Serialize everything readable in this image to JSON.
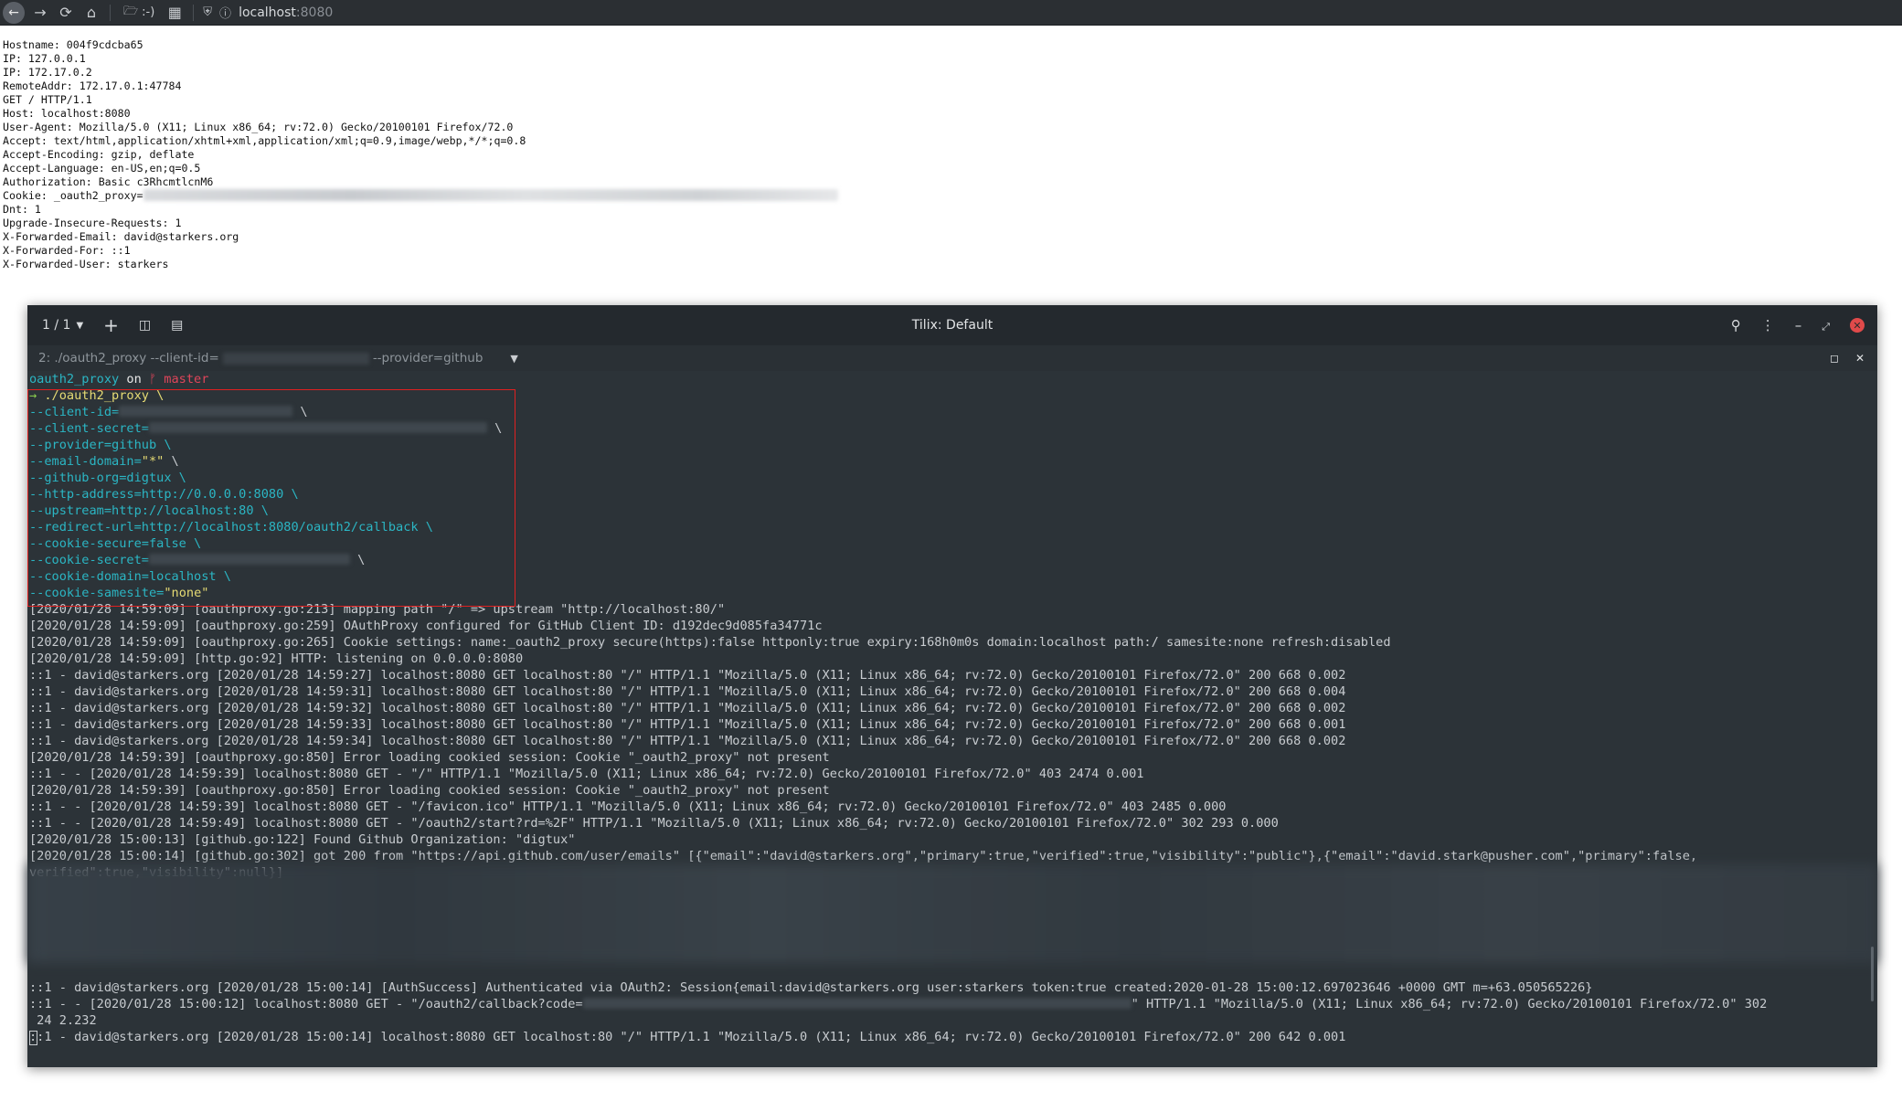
{
  "browser": {
    "folder_label": ":-)",
    "url_host": "localhost",
    "url_port": ":8080"
  },
  "echo_lines": [
    "Hostname: 004f9cdcba65",
    "IP: 127.0.0.1",
    "IP: 172.17.0.2",
    "RemoteAddr: 172.17.0.1:47784",
    "GET / HTTP/1.1",
    "Host: localhost:8080",
    "User-Agent: Mozilla/5.0 (X11; Linux x86_64; rv:72.0) Gecko/20100101 Firefox/72.0",
    "Accept: text/html,application/xhtml+xml,application/xml;q=0.9,image/webp,*/*;q=0.8",
    "Accept-Encoding: gzip, deflate",
    "Accept-Language: en-US,en;q=0.5",
    "Authorization: Basic c3RhcmtlcnM6",
    "Cookie: _oauth2_proxy=",
    "Dnt: 1",
    "Upgrade-Insecure-Requests: 1",
    "X-Forwarded-Email: david@starkers.org",
    "X-Forwarded-For: ::1",
    "X-Forwarded-User: starkers"
  ],
  "tilix": {
    "session_counter": "1 / 1",
    "title": "Tilix: Default",
    "tab_title_prefix": "2: ./oauth2_proxy --client-id=",
    "tab_title_suffix": "--provider=github"
  },
  "terminal": {
    "prompt_dir": "oauth2_proxy",
    "prompt_on": "on",
    "prompt_branch": "ᚠ master",
    "cmd_arrow": "→",
    "cmd": "./oauth2_proxy \\",
    "args": [
      "--client-id=",
      "--client-secret=",
      "--provider=github \\",
      "--email-domain=",
      "--github-org=digtux \\",
      "--http-address=http://0.0.0.0:8080 \\",
      "--upstream=http://localhost:80 \\",
      "--redirect-url=http://localhost:8080/oauth2/callback \\",
      "--cookie-secure=false \\",
      "--cookie-secret=",
      "--cookie-domain=localhost \\",
      "--cookie-samesite="
    ],
    "email_domain_value": "\"*\"",
    "samesite_value": "\"none\"",
    "backslash": "\\",
    "log_lines": [
      "[2020/01/28 14:59:09] [oauthproxy.go:213] mapping path \"/\" => upstream \"http://localhost:80/\"",
      "[2020/01/28 14:59:09] [oauthproxy.go:259] OAuthProxy configured for GitHub Client ID: d192dec9d085fa34771c",
      "[2020/01/28 14:59:09] [oauthproxy.go:265] Cookie settings: name:_oauth2_proxy secure(https):false httponly:true expiry:168h0m0s domain:localhost path:/ samesite:none refresh:disabled",
      "[2020/01/28 14:59:09] [http.go:92] HTTP: listening on 0.0.0.0:8080",
      "::1 - david@starkers.org [2020/01/28 14:59:27] localhost:8080 GET localhost:80 \"/\" HTTP/1.1 \"Mozilla/5.0 (X11; Linux x86_64; rv:72.0) Gecko/20100101 Firefox/72.0\" 200 668 0.002",
      "::1 - david@starkers.org [2020/01/28 14:59:31] localhost:8080 GET localhost:80 \"/\" HTTP/1.1 \"Mozilla/5.0 (X11; Linux x86_64; rv:72.0) Gecko/20100101 Firefox/72.0\" 200 668 0.004",
      "::1 - david@starkers.org [2020/01/28 14:59:32] localhost:8080 GET localhost:80 \"/\" HTTP/1.1 \"Mozilla/5.0 (X11; Linux x86_64; rv:72.0) Gecko/20100101 Firefox/72.0\" 200 668 0.002",
      "::1 - david@starkers.org [2020/01/28 14:59:33] localhost:8080 GET localhost:80 \"/\" HTTP/1.1 \"Mozilla/5.0 (X11; Linux x86_64; rv:72.0) Gecko/20100101 Firefox/72.0\" 200 668 0.001",
      "::1 - david@starkers.org [2020/01/28 14:59:34] localhost:8080 GET localhost:80 \"/\" HTTP/1.1 \"Mozilla/5.0 (X11; Linux x86_64; rv:72.0) Gecko/20100101 Firefox/72.0\" 200 668 0.002",
      "[2020/01/28 14:59:39] [oauthproxy.go:850] Error loading cookied session: Cookie \"_oauth2_proxy\" not present",
      "::1 - - [2020/01/28 14:59:39] localhost:8080 GET - \"/\" HTTP/1.1 \"Mozilla/5.0 (X11; Linux x86_64; rv:72.0) Gecko/20100101 Firefox/72.0\" 403 2474 0.001",
      "[2020/01/28 14:59:39] [oauthproxy.go:850] Error loading cookied session: Cookie \"_oauth2_proxy\" not present",
      "::1 - - [2020/01/28 14:59:39] localhost:8080 GET - \"/favicon.ico\" HTTP/1.1 \"Mozilla/5.0 (X11; Linux x86_64; rv:72.0) Gecko/20100101 Firefox/72.0\" 403 2485 0.000",
      "::1 - - [2020/01/28 14:59:49] localhost:8080 GET - \"/oauth2/start?rd=%2F\" HTTP/1.1 \"Mozilla/5.0 (X11; Linux x86_64; rv:72.0) Gecko/20100101 Firefox/72.0\" 302 293 0.000",
      "[2020/01/28 15:00:13] [github.go:122] Found Github Organization: \"digtux\"",
      "[2020/01/28 15:00:14] [github.go:302] got 200 from \"https://api.github.com/user/emails\" [{\"email\":\"david@starkers.org\",\"primary\":true,\"verified\":true,\"visibility\":\"public\"},{\"email\":\"david.stark@pusher.com\",\"primary\":false,",
      "verified\":true,\"visibility\":null}]"
    ],
    "tail_lines": [
      "::1 - david@starkers.org [2020/01/28 15:00:14] [AuthSuccess] Authenticated via OAuth2: Session{email:david@starkers.org user:starkers token:true created:2020-01-28 15:00:12.697023646 +0000 GMT m=+63.050565226}",
      "::1 - - [2020/01/28 15:00:12] localhost:8080 GET - \"/oauth2/callback?code=",
      "\" HTTP/1.1 \"Mozilla/5.0 (X11; Linux x86_64; rv:72.0) Gecko/20100101 Firefox/72.0\" 302",
      " 24 2.232",
      "::1 - david@starkers.org [2020/01/28 15:00:14] localhost:8080 GET localhost:80 \"/\" HTTP/1.1 \"Mozilla/5.0 (X11; Linux x86_64; rv:72.0) Gecko/20100101 Firefox/72.0\" 200 642 0.001"
    ]
  }
}
